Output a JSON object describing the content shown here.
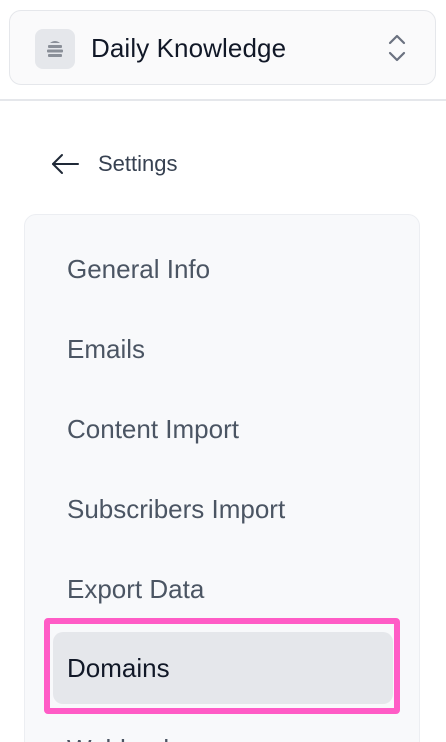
{
  "workspace": {
    "name": "Daily Knowledge",
    "logo_icon": "beehive-icon",
    "switcher_icon": "chevron-up-down-icon"
  },
  "nav": {
    "back_label": "Settings",
    "back_icon": "arrow-left-icon"
  },
  "settings_menu": {
    "items": [
      {
        "label": "General Info",
        "active": false
      },
      {
        "label": "Emails",
        "active": false
      },
      {
        "label": "Content Import",
        "active": false
      },
      {
        "label": "Subscribers Import",
        "active": false
      },
      {
        "label": "Export Data",
        "active": false
      },
      {
        "label": "Domains",
        "active": true
      },
      {
        "label": "Webhooks",
        "active": false
      }
    ]
  },
  "colors": {
    "highlight": "#ff5cc6",
    "active_bg": "#e5e7eb",
    "panel_bg": "#f8f9fb"
  }
}
